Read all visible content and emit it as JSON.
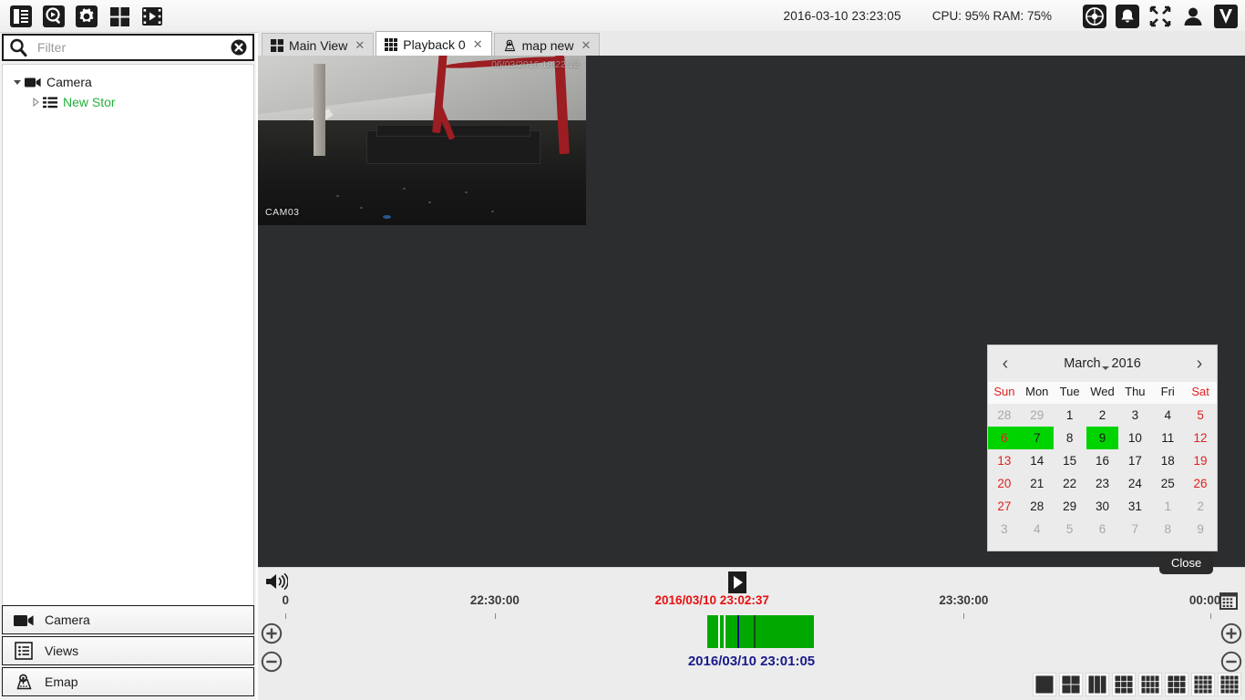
{
  "header": {
    "timestamp": "2016-03-10 23:23:05",
    "resources": "CPU: 95%  RAM: 75%",
    "tools": [
      {
        "name": "layout-list-icon",
        "label": "Layout"
      },
      {
        "name": "search-playback-icon",
        "label": "Search"
      },
      {
        "name": "gear-icon",
        "label": "Settings"
      },
      {
        "name": "grid-view-icon",
        "label": "View Grid"
      },
      {
        "name": "film-icon",
        "label": "Video"
      }
    ],
    "right_icons": [
      {
        "name": "compass-icon",
        "label": "PTZ"
      },
      {
        "name": "bell-icon",
        "label": "Alarms"
      },
      {
        "name": "fullscreen-icon",
        "label": "Fullscreen"
      },
      {
        "name": "user-icon",
        "label": "Account"
      },
      {
        "name": "app-logo-icon",
        "label": "V"
      }
    ]
  },
  "sidebar": {
    "filter": {
      "value": "",
      "placeholder": "Filter"
    },
    "tree": [
      {
        "label": "Camera",
        "level": 1,
        "expanded": true,
        "color": "default"
      },
      {
        "label": "New Stor",
        "level": 2,
        "expanded": false,
        "color": "green"
      }
    ],
    "panel_buttons": [
      {
        "label": "Camera",
        "icon": "camera-icon"
      },
      {
        "label": "Views",
        "icon": "views-list-icon"
      },
      {
        "label": "Emap",
        "icon": "emap-pin-icon"
      }
    ]
  },
  "tabs": [
    {
      "label": "Main View",
      "icon": "grid-icon",
      "active": false
    },
    {
      "label": "Playback 0",
      "icon": "grid-icon",
      "active": true
    },
    {
      "label": "map new",
      "icon": "map-icon",
      "active": false
    }
  ],
  "video": {
    "rows": 3,
    "columns": 3,
    "cells": [
      {
        "camera": "CAM03",
        "osd": "06/03/2016 18:22:13",
        "selected": true,
        "has_video": true
      },
      {
        "camera": "",
        "osd": "",
        "selected": false,
        "has_video": false
      },
      {
        "camera": "",
        "osd": "",
        "selected": false,
        "has_video": false
      },
      {
        "camera": "",
        "osd": "",
        "selected": false,
        "has_video": false
      },
      {
        "camera": "",
        "osd": "",
        "selected": false,
        "has_video": false
      },
      {
        "camera": "",
        "osd": "",
        "selected": false,
        "has_video": false
      },
      {
        "camera": "",
        "osd": "",
        "selected": false,
        "has_video": false
      },
      {
        "camera": "",
        "osd": "",
        "selected": false,
        "has_video": false
      },
      {
        "camera": "",
        "osd": "",
        "selected": false,
        "has_video": false
      }
    ]
  },
  "calendar": {
    "month": "March",
    "year": "2016",
    "prev_label": "‹",
    "next_label": "›",
    "weekdays": [
      "Sun",
      "Mon",
      "Tue",
      "Wed",
      "Thu",
      "Fri",
      "Sat"
    ],
    "weeks": [
      [
        {
          "d": "28",
          "out": true
        },
        {
          "d": "29",
          "out": true
        },
        {
          "d": "1"
        },
        {
          "d": "2"
        },
        {
          "d": "3"
        },
        {
          "d": "4"
        },
        {
          "d": "5"
        }
      ],
      [
        {
          "d": "6",
          "hl": true
        },
        {
          "d": "7",
          "hl": true
        },
        {
          "d": "8"
        },
        {
          "d": "9",
          "hl": true
        },
        {
          "d": "10"
        },
        {
          "d": "11"
        },
        {
          "d": "12"
        }
      ],
      [
        {
          "d": "13"
        },
        {
          "d": "14"
        },
        {
          "d": "15"
        },
        {
          "d": "16"
        },
        {
          "d": "17"
        },
        {
          "d": "18"
        },
        {
          "d": "19"
        }
      ],
      [
        {
          "d": "20"
        },
        {
          "d": "21"
        },
        {
          "d": "22"
        },
        {
          "d": "23"
        },
        {
          "d": "24"
        },
        {
          "d": "25"
        },
        {
          "d": "26"
        }
      ],
      [
        {
          "d": "27"
        },
        {
          "d": "28"
        },
        {
          "d": "29"
        },
        {
          "d": "30"
        },
        {
          "d": "31"
        },
        {
          "d": "1",
          "out": true
        },
        {
          "d": "2",
          "out": true
        }
      ],
      [
        {
          "d": "3",
          "out": true
        },
        {
          "d": "4",
          "out": true
        },
        {
          "d": "5",
          "out": true
        },
        {
          "d": "6",
          "out": true
        },
        {
          "d": "7",
          "out": true
        },
        {
          "d": "8",
          "out": true
        },
        {
          "d": "9",
          "out": true
        }
      ]
    ],
    "highlight_color": "#00d400",
    "weekend_color": "#e02020"
  },
  "tooltip": {
    "text": "Close"
  },
  "timeline": {
    "ticks": [
      {
        "label": "0",
        "pos_pct": 2.8
      },
      {
        "label": "22:30:00",
        "pos_pct": 24.0
      },
      {
        "label": "23:30:00",
        "pos_pct": 71.5
      },
      {
        "label": "00:00:0",
        "pos_pct": 96.5
      }
    ],
    "current_label": "2016/03/10  23:02:37",
    "current_pos_pct": 46.0,
    "selected_label": "2016/03/10 23:01:05",
    "recording": {
      "start_pct": 45.5,
      "width_pct": 10.8,
      "color": "#00a800"
    },
    "markers": [
      {
        "pos_pct": 46.6,
        "color": "#ffffff"
      },
      {
        "pos_pct": 47.2,
        "color": "#ffffff"
      },
      {
        "pos_pct": 48.6,
        "color": "#10107a"
      },
      {
        "pos_pct": 50.2,
        "color": "#1a4a1a"
      }
    ],
    "zoom_in_label": "+",
    "zoom_out_label": "−",
    "speaker_icon": "volume-icon",
    "play_icon": "play-icon",
    "calendar_icon": "calendar-icon"
  },
  "layout_presets": [
    {
      "name": "layout-1x1",
      "cols": 1,
      "rows": 1
    },
    {
      "name": "layout-2x2",
      "cols": 2,
      "rows": 2
    },
    {
      "name": "layout-1x3",
      "cols": 3,
      "rows": 1
    },
    {
      "name": "layout-1plus5",
      "cols": 3,
      "rows": 3
    },
    {
      "name": "layout-3x4",
      "cols": 4,
      "rows": 3
    },
    {
      "name": "layout-3x3",
      "cols": 3,
      "rows": 3
    },
    {
      "name": "layout-1plus12",
      "cols": 4,
      "rows": 4
    },
    {
      "name": "layout-4x4",
      "cols": 4,
      "rows": 4
    }
  ]
}
